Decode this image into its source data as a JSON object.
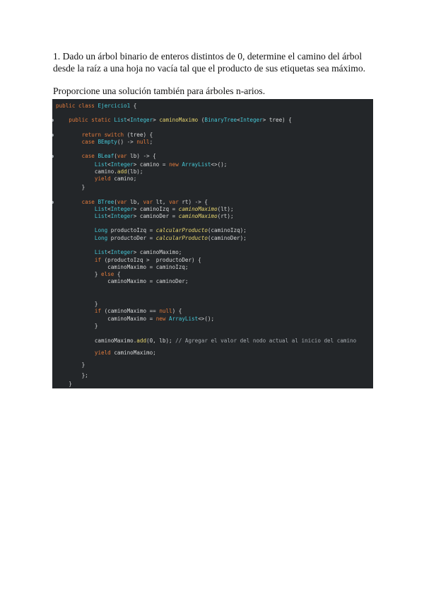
{
  "question": {
    "text": "1. Dado un árbol binario de enteros distintos de 0, determine el camino del árbol desde la raíz a una hoja no vacía tal que el producto de sus etiquetas sea máximo.",
    "subtext": "Proporcione una solución también para árboles n-arios."
  },
  "code": {
    "lines": [
      [
        [
          "kw",
          "public class "
        ],
        [
          "ty",
          "Ejercicio1"
        ],
        [
          "var",
          " {"
        ]
      ],
      [
        [
          "var",
          "    "
        ],
        [
          "kw",
          "public static "
        ],
        [
          "ty",
          "List"
        ],
        [
          "var",
          "<"
        ],
        [
          "ty",
          "Integer"
        ],
        [
          "var",
          "> "
        ],
        [
          "fn",
          "caminoMaximo"
        ],
        [
          "var",
          " ("
        ],
        [
          "ty",
          "BinaryTree"
        ],
        [
          "var",
          "<"
        ],
        [
          "ty",
          "Integer"
        ],
        [
          "var",
          "> "
        ],
        [
          "var",
          "tree) {"
        ]
      ],
      [
        [
          "var",
          "        "
        ],
        [
          "kw",
          "return switch "
        ],
        [
          "var",
          "(tree) {"
        ]
      ],
      [
        [
          "var",
          "        "
        ],
        [
          "kw",
          "case "
        ],
        [
          "ty",
          "BEmpty"
        ],
        [
          "var",
          "() -> "
        ],
        [
          "kw",
          "null"
        ],
        [
          "var",
          ";"
        ]
      ],
      [
        [
          "var",
          "        "
        ],
        [
          "kw",
          "case "
        ],
        [
          "ty",
          "BLeaf"
        ],
        [
          "var",
          "("
        ],
        [
          "kw",
          "var "
        ],
        [
          "var",
          "lb) -> {"
        ]
      ],
      [
        [
          "var",
          "            "
        ],
        [
          "ty",
          "List"
        ],
        [
          "var",
          "<"
        ],
        [
          "ty",
          "Integer"
        ],
        [
          "var",
          "> camino = "
        ],
        [
          "kw",
          "new "
        ],
        [
          "ty",
          "ArrayList"
        ],
        [
          "var",
          "<>();"
        ]
      ],
      [
        [
          "var",
          "            camino."
        ],
        [
          "fn",
          "add"
        ],
        [
          "var",
          "(lb);"
        ]
      ],
      [
        [
          "var",
          "            "
        ],
        [
          "kw",
          "yield "
        ],
        [
          "var",
          "camino;"
        ]
      ],
      [
        [
          "var",
          "        }"
        ]
      ],
      [
        [
          "var",
          "        "
        ],
        [
          "kw",
          "case "
        ],
        [
          "ty",
          "BTree"
        ],
        [
          "var",
          "("
        ],
        [
          "kw",
          "var "
        ],
        [
          "var",
          "lb, "
        ],
        [
          "kw",
          "var "
        ],
        [
          "var",
          "lt, "
        ],
        [
          "kw",
          "var "
        ],
        [
          "var",
          "rt) -> {"
        ]
      ],
      [
        [
          "var",
          "            "
        ],
        [
          "ty",
          "List"
        ],
        [
          "var",
          "<"
        ],
        [
          "ty",
          "Integer"
        ],
        [
          "var",
          "> caminoIzq = "
        ],
        [
          "it",
          "caminoMaximo"
        ],
        [
          "var",
          "(lt);"
        ]
      ],
      [
        [
          "var",
          "            "
        ],
        [
          "ty",
          "List"
        ],
        [
          "var",
          "<"
        ],
        [
          "ty",
          "Integer"
        ],
        [
          "var",
          "> caminoDer = "
        ],
        [
          "it",
          "caminoMaximo"
        ],
        [
          "var",
          "(rt);"
        ]
      ],
      [
        [
          "var",
          "            "
        ],
        [
          "ty",
          "Long "
        ],
        [
          "var",
          "productoIzq = "
        ],
        [
          "it",
          "calcularProducto"
        ],
        [
          "var",
          "(caminoIzq);"
        ]
      ],
      [
        [
          "var",
          "            "
        ],
        [
          "ty",
          "Long "
        ],
        [
          "var",
          "productoDer = "
        ],
        [
          "it",
          "calcularProducto"
        ],
        [
          "var",
          "(caminoDer);"
        ]
      ],
      [
        [
          "var",
          "            "
        ],
        [
          "ty",
          "List"
        ],
        [
          "var",
          "<"
        ],
        [
          "ty",
          "Integer"
        ],
        [
          "var",
          "> caminoMaximo;"
        ]
      ],
      [
        [
          "var",
          "            "
        ],
        [
          "kw",
          "if "
        ],
        [
          "var",
          "(productoIzq >  productoDer) {"
        ]
      ],
      [
        [
          "var",
          "                caminoMaximo = caminoIzq;"
        ]
      ],
      [
        [
          "var",
          "            } "
        ],
        [
          "kw",
          "else "
        ],
        [
          "var",
          "{"
        ]
      ],
      [
        [
          "var",
          "                caminoMaximo = caminoDer;"
        ]
      ],
      [
        [
          "var",
          "            }"
        ]
      ],
      [
        [
          "var",
          "            "
        ],
        [
          "kw",
          "if "
        ],
        [
          "var",
          "(caminoMaximo == "
        ],
        [
          "kw",
          "null"
        ],
        [
          "var",
          ") {"
        ]
      ],
      [
        [
          "var",
          "                caminoMaximo = "
        ],
        [
          "kw",
          "new "
        ],
        [
          "ty",
          "ArrayList"
        ],
        [
          "var",
          "<>();"
        ]
      ],
      [
        [
          "var",
          "            }"
        ]
      ],
      [
        [
          "var",
          "            caminoMaximo."
        ],
        [
          "fn",
          "add"
        ],
        [
          "var",
          "(0, lb); "
        ],
        [
          "cm",
          "// Agregar el valor del nodo actual al inicio del camino"
        ]
      ],
      [
        [
          "var",
          "            "
        ],
        [
          "kw",
          "yield "
        ],
        [
          "var",
          "caminoMaximo;"
        ]
      ],
      [
        [
          "var",
          "        }"
        ]
      ],
      [
        [
          "var",
          "        };"
        ]
      ],
      [
        [
          "var",
          "    }"
        ]
      ]
    ]
  }
}
